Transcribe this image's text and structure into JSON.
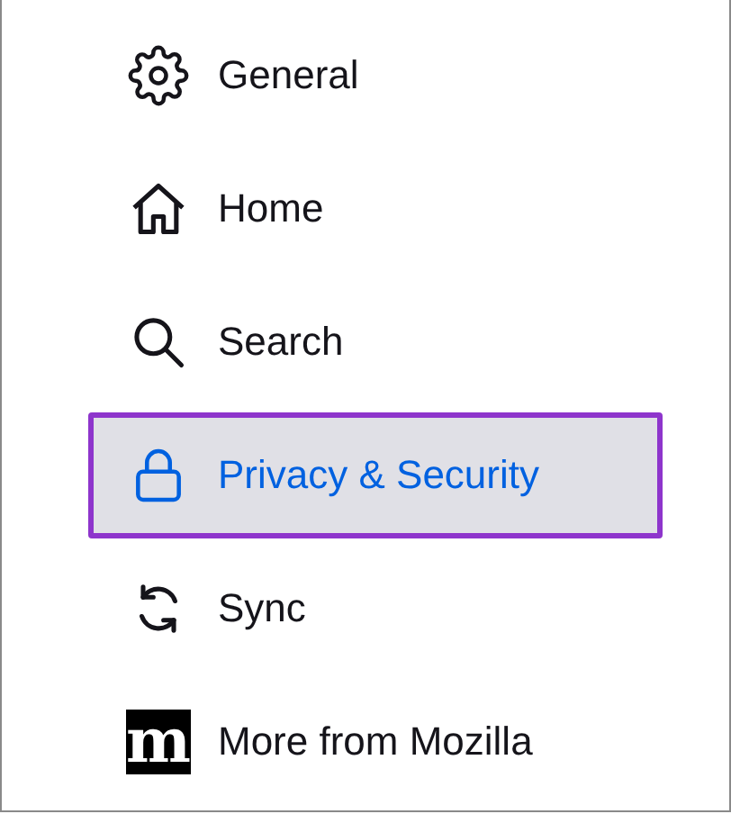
{
  "sidebar": {
    "items": [
      {
        "label": "General",
        "selected": false
      },
      {
        "label": "Home",
        "selected": false
      },
      {
        "label": "Search",
        "selected": false
      },
      {
        "label": "Privacy & Security",
        "selected": true
      },
      {
        "label": "Sync",
        "selected": false
      },
      {
        "label": "More from Mozilla",
        "selected": false,
        "logo_text": "m"
      }
    ]
  }
}
